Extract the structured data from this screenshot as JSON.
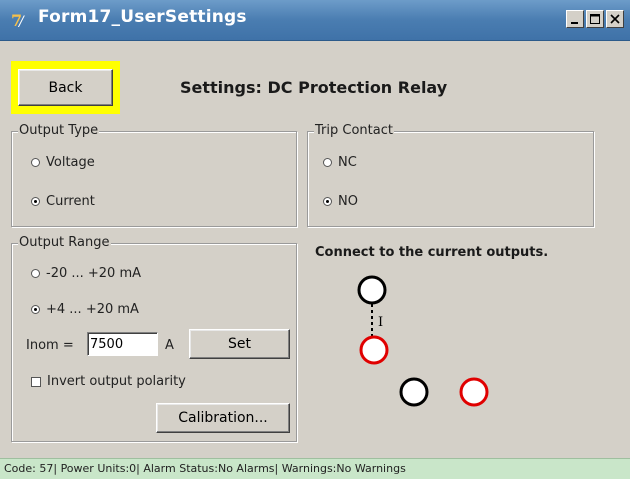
{
  "window": {
    "title": "Form17_UserSettings",
    "icon": "app-logo-icon",
    "buttons": {
      "minimize": "minimize-icon",
      "maximize": "maximize-icon",
      "close": "close-icon"
    }
  },
  "header": {
    "back_label": "Back",
    "title": "Settings: DC Protection Relay"
  },
  "output_type": {
    "title": "Output Type",
    "options": [
      {
        "label": "Voltage",
        "selected": false
      },
      {
        "label": "Current",
        "selected": true
      }
    ]
  },
  "trip_contact": {
    "title": "Trip Contact",
    "options": [
      {
        "label": "NC",
        "selected": false
      },
      {
        "label": "NO",
        "selected": true
      }
    ]
  },
  "output_range": {
    "title": "Output Range",
    "options": [
      {
        "label": "-20 ... +20 mA",
        "selected": false
      },
      {
        "label": "+4 ... +20 mA",
        "selected": true
      }
    ],
    "inom_label": "Inom =",
    "inom_value": "7500",
    "inom_unit": "A",
    "set_label": "Set",
    "invert_label": "Invert output polarity",
    "invert_checked": false,
    "calibration_label": "Calibration..."
  },
  "connection": {
    "text": "Connect to the current outputs.",
    "current_symbol": "I"
  },
  "status_bar": {
    "text": "Code: 57| Power Units:0| Alarm Status:No Alarms| Warnings:No Warnings"
  },
  "colors": {
    "titlebar": "#4a7db1",
    "highlight": "#ffff00",
    "status_bar": "#c9e6c9",
    "terminal_red": "#e00000",
    "terminal_black": "#000000"
  }
}
